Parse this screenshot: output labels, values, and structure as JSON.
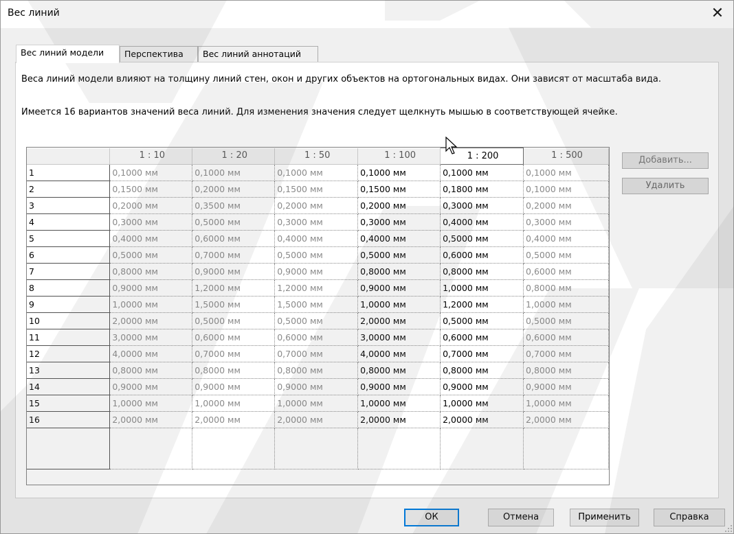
{
  "window": {
    "title": "Вес линий",
    "close_icon": "close-icon"
  },
  "tabs": [
    {
      "label": "Вес линий модели",
      "active": true
    },
    {
      "label": "Перспектива",
      "active": false
    },
    {
      "label": "Вес линий аннотаций",
      "active": false
    }
  ],
  "description": {
    "line1": "Веса линий модели влияют на толщину линий стен, окон и других объектов на ортогональных видах. Они зависят от масштаба вида.",
    "line2": "Имеется 16 вариантов значений веса линий. Для изменения значения следует щелкнуть мышью в соответствующей ячейке."
  },
  "table": {
    "columns": [
      "1 : 10",
      "1 : 20",
      "1 : 50",
      "1 : 100",
      "1 : 200",
      "1 : 500"
    ],
    "selected_column": "1 : 200",
    "rows": [
      {
        "id": "1",
        "values": [
          "0,1000 мм",
          "0,1000 мм",
          "0,1000 мм",
          "0,1000 мм",
          "0,1000 мм",
          "0,1000 мм"
        ]
      },
      {
        "id": "2",
        "values": [
          "0,1500 мм",
          "0,2000 мм",
          "0,1500 мм",
          "0,1500 мм",
          "0,1800 мм",
          "0,1000 мм"
        ]
      },
      {
        "id": "3",
        "values": [
          "0,2000 мм",
          "0,3500 мм",
          "0,2000 мм",
          "0,2000 мм",
          "0,3000 мм",
          "0,2000 мм"
        ]
      },
      {
        "id": "4",
        "values": [
          "0,3000 мм",
          "0,5000 мм",
          "0,3000 мм",
          "0,3000 мм",
          "0,4000 мм",
          "0,3000 мм"
        ]
      },
      {
        "id": "5",
        "values": [
          "0,4000 мм",
          "0,6000 мм",
          "0,4000 мм",
          "0,4000 мм",
          "0,5000 мм",
          "0,4000 мм"
        ]
      },
      {
        "id": "6",
        "values": [
          "0,5000 мм",
          "0,7000 мм",
          "0,5000 мм",
          "0,5000 мм",
          "0,6000 мм",
          "0,5000 мм"
        ]
      },
      {
        "id": "7",
        "values": [
          "0,8000 мм",
          "0,9000 мм",
          "0,9000 мм",
          "0,8000 мм",
          "0,8000 мм",
          "0,6000 мм"
        ]
      },
      {
        "id": "8",
        "values": [
          "0,9000 мм",
          "1,2000 мм",
          "1,2000 мм",
          "0,9000 мм",
          "1,0000 мм",
          "0,8000 мм"
        ]
      },
      {
        "id": "9",
        "values": [
          "1,0000 мм",
          "1,5000 мм",
          "1,5000 мм",
          "1,0000 мм",
          "1,2000 мм",
          "1,0000 мм"
        ]
      },
      {
        "id": "10",
        "values": [
          "2,0000 мм",
          "0,5000 мм",
          "0,5000 мм",
          "2,0000 мм",
          "0,5000 мм",
          "0,5000 мм"
        ]
      },
      {
        "id": "11",
        "values": [
          "3,0000 мм",
          "0,6000 мм",
          "0,6000 мм",
          "3,0000 мм",
          "0,6000 мм",
          "0,6000 мм"
        ]
      },
      {
        "id": "12",
        "values": [
          "4,0000 мм",
          "0,7000 мм",
          "0,7000 мм",
          "4,0000 мм",
          "0,7000 мм",
          "0,7000 мм"
        ]
      },
      {
        "id": "13",
        "values": [
          "0,8000 мм",
          "0,8000 мм",
          "0,8000 мм",
          "0,8000 мм",
          "0,8000 мм",
          "0,8000 мм"
        ]
      },
      {
        "id": "14",
        "values": [
          "0,9000 мм",
          "0,9000 мм",
          "0,9000 мм",
          "0,9000 мм",
          "0,9000 мм",
          "0,9000 мм"
        ]
      },
      {
        "id": "15",
        "values": [
          "1,0000 мм",
          "1,0000 мм",
          "1,0000 мм",
          "1,0000 мм",
          "1,0000 мм",
          "1,0000 мм"
        ]
      },
      {
        "id": "16",
        "values": [
          "2,0000 мм",
          "2,0000 мм",
          "2,0000 мм",
          "2,0000 мм",
          "2,0000 мм",
          "2,0000 мм"
        ]
      }
    ]
  },
  "side_buttons": {
    "add": "Добавить...",
    "delete": "Удалить"
  },
  "footer_buttons": {
    "ok": "ОК",
    "cancel": "Отмена",
    "apply": "Применить",
    "help": "Справка"
  },
  "colors": {
    "accent": "#0078d7",
    "dialog_bg": "#f0f0f0",
    "watermark": "#7a7a7a"
  }
}
